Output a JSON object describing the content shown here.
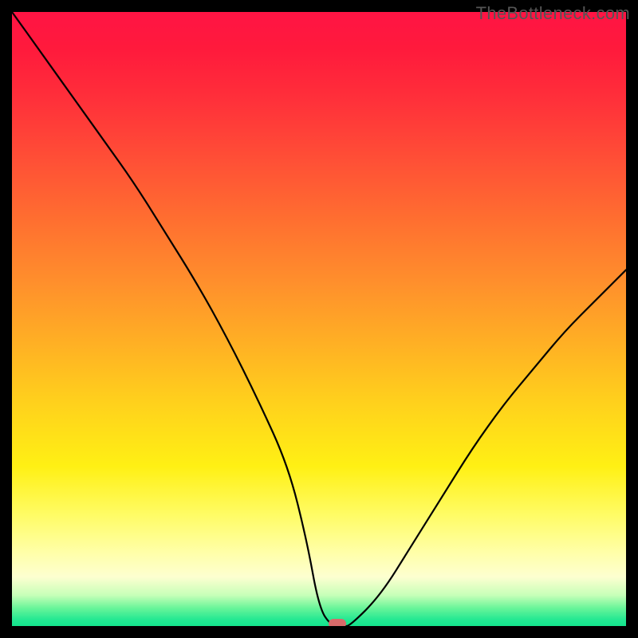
{
  "watermark": "TheBottleneck.com",
  "chart_data": {
    "type": "line",
    "title": "",
    "xlabel": "",
    "ylabel": "",
    "xlim": [
      0,
      100
    ],
    "ylim": [
      0,
      100
    ],
    "grid": false,
    "legend": false,
    "series": [
      {
        "name": "bottleneck-curve",
        "x": [
          0,
          5,
          10,
          15,
          20,
          25,
          30,
          35,
          40,
          45,
          48,
          50,
          52,
          54,
          55,
          60,
          65,
          70,
          75,
          80,
          85,
          90,
          95,
          100
        ],
        "values": [
          100,
          93,
          86,
          79,
          72,
          64,
          56,
          47,
          37,
          26,
          14,
          3,
          0,
          0,
          0,
          5,
          13,
          21,
          29,
          36,
          42,
          48,
          53,
          58
        ]
      }
    ],
    "marker": {
      "x": 53,
      "y": 0
    },
    "background_gradient": {
      "top": "#ff1444",
      "mid": "#ffd21c",
      "bottom": "#14e48c"
    }
  }
}
